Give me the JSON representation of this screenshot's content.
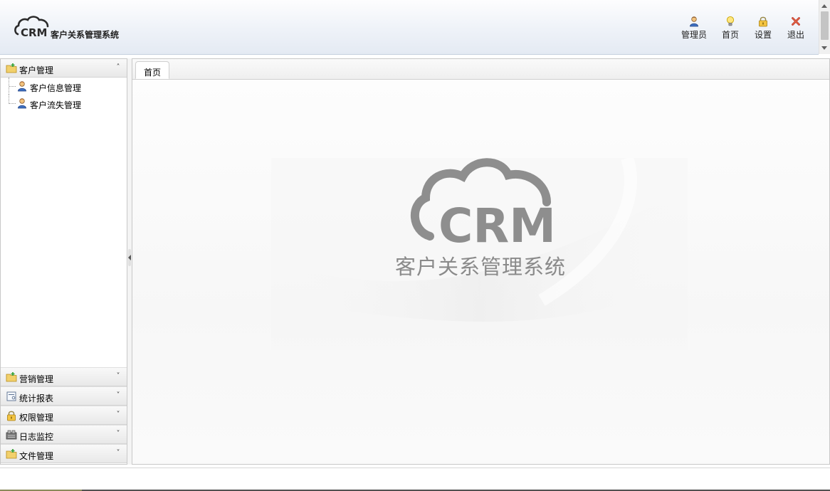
{
  "header": {
    "logo_mark": "CRM",
    "app_title": "客户关系管理系统",
    "actions": [
      {
        "label": "管理员",
        "icon": "user-icon"
      },
      {
        "label": "首页",
        "icon": "lightbulb-icon"
      },
      {
        "label": "设置",
        "icon": "lock-icon"
      },
      {
        "label": "退出",
        "icon": "close-x-icon"
      }
    ]
  },
  "sidebar": {
    "open_section": {
      "title": "客户管理",
      "icon": "folder-icon",
      "items": [
        {
          "label": "客户信息管理",
          "icon": "user-icon"
        },
        {
          "label": "客户流失管理",
          "icon": "user-icon"
        }
      ]
    },
    "closed_sections": [
      {
        "title": "营销管理",
        "icon": "folder-icon"
      },
      {
        "title": "统计报表",
        "icon": "report-icon"
      },
      {
        "title": "权限管理",
        "icon": "lock-icon"
      },
      {
        "title": "日志监控",
        "icon": "monitor-icon"
      },
      {
        "title": "文件管理",
        "icon": "folder-icon"
      }
    ]
  },
  "main": {
    "tabs": [
      {
        "label": "首页"
      }
    ],
    "welcome_logo": "CRM",
    "welcome_title": "客户关系管理系统"
  },
  "colors": {
    "accent_orange": "#e8a23a",
    "logo_gray": "#8a8a8a",
    "close_red": "#c0392b"
  }
}
